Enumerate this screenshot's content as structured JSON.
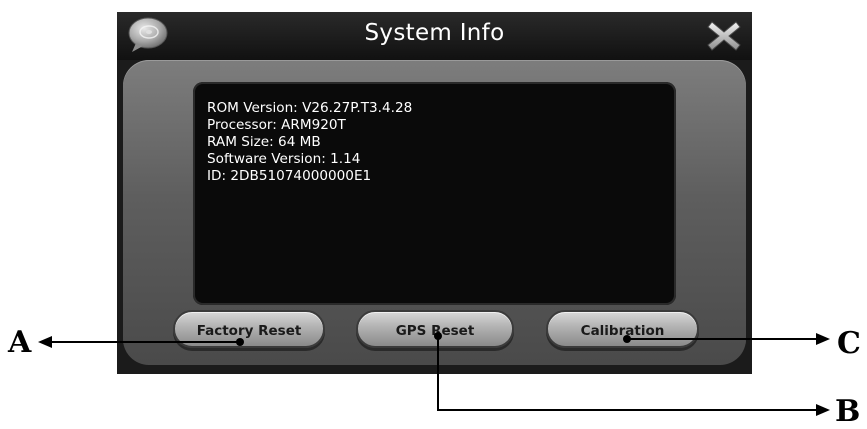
{
  "window": {
    "title": "System Info"
  },
  "icons": {
    "chat": "chat-bubble-icon",
    "close": "close-x-icon"
  },
  "info": {
    "lines": [
      "ROM Version: V26.27P.T3.4.28",
      "Processor: ARM920T",
      "RAM Size: 64 MB",
      "Software Version: 1.14",
      "ID: 2DB51074000000E1"
    ]
  },
  "buttons": {
    "factory_reset": "Factory Reset",
    "gps_reset": "GPS Reset",
    "calibration": "Calibration"
  },
  "callouts": {
    "a": "A",
    "b": "B",
    "c": "C"
  },
  "colors": {
    "screen_background": "#1b1b1b",
    "panel": "#5e5e5e",
    "info_box": "#0a0a0a",
    "button": "#b5b5b5",
    "text_light": "#ffffff"
  }
}
